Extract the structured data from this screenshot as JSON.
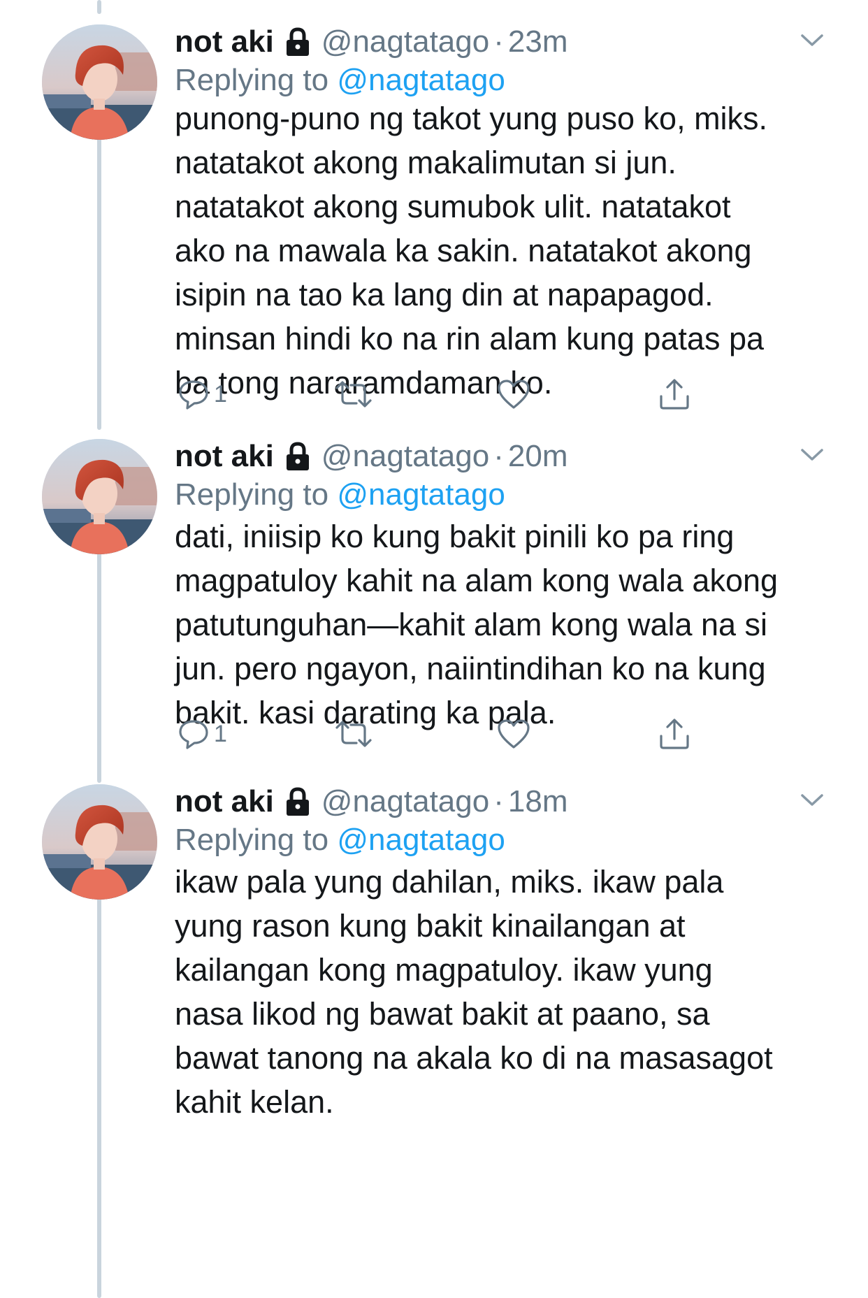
{
  "colors": {
    "text": "#14171a",
    "secondary": "#657786",
    "mention": "#1da1f2",
    "thread_line": "#c9d4dd"
  },
  "tweets": [
    {
      "display_name": "not aki",
      "handle": "@nagtatago",
      "separator": "·",
      "time": "23m",
      "replying_prefix": "Replying to",
      "replying_to": "@nagtatago",
      "lines": [
        "punong-puno ng takot yung puso ko, miks.",
        "natatakot akong makalimutan si jun.",
        "natatakot akong sumubok ulit. natatakot",
        "ako na mawala ka sakin. natatakot akong",
        "isipin na tao ka lang din at napapagod.",
        "minsan hindi ko na rin alam kung patas pa",
        "ba tong nararamdaman ko."
      ],
      "reply_count": "1",
      "icons": [
        "lock-icon",
        "chevron-down-icon",
        "reply-icon",
        "retweet-icon",
        "like-icon",
        "share-icon"
      ]
    },
    {
      "display_name": "not aki",
      "handle": "@nagtatago",
      "separator": "·",
      "time": "20m",
      "replying_prefix": "Replying to",
      "replying_to": "@nagtatago",
      "lines": [
        "dati, iniisip ko kung bakit pinili ko pa ring",
        "magpatuloy kahit na alam kong wala akong",
        "patutunguhan—kahit alam kong wala na si",
        "jun. pero ngayon, naiintindihan ko na kung",
        "bakit. kasi darating ka pala."
      ],
      "reply_count": "1",
      "icons": [
        "lock-icon",
        "chevron-down-icon",
        "reply-icon",
        "retweet-icon",
        "like-icon",
        "share-icon"
      ]
    },
    {
      "display_name": "not aki",
      "handle": "@nagtatago",
      "separator": "·",
      "time": "18m",
      "replying_prefix": "Replying to",
      "replying_to": "@nagtatago",
      "lines": [
        "ikaw pala yung dahilan, miks. ikaw pala",
        "yung rason kung bakit kinailangan at",
        "kailangan kong magpatuloy. ikaw yung",
        "nasa likod ng bawat bakit at paano, sa",
        "bawat tanong na akala ko di na masasagot",
        "kahit kelan."
      ],
      "reply_count": "",
      "icons": [
        "lock-icon",
        "chevron-down-icon"
      ]
    }
  ]
}
